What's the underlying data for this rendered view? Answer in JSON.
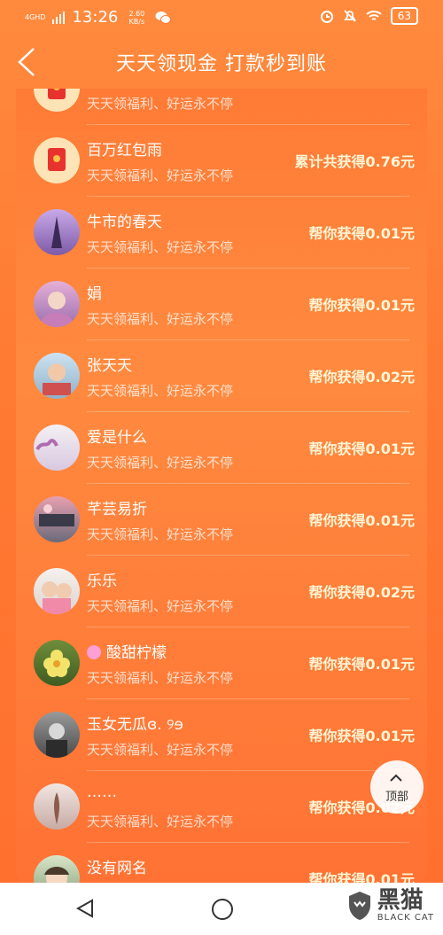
{
  "status": {
    "network": "4GHD",
    "time": "13:26",
    "speed": "2.60 KB/s",
    "battery": "63",
    "icons": [
      "signal-icon",
      "wechat-icon",
      "alarm-icon",
      "mute-icon",
      "wifi-icon",
      "battery-icon"
    ]
  },
  "header": {
    "title": "天天领现金 打款秒到账",
    "back_icon": "back-chevron-icon"
  },
  "rows": [
    {
      "name": "",
      "sub": "天天领福利、好运永不停",
      "amount": ""
    },
    {
      "name": "百万红包雨",
      "sub": "天天领福利、好运永不停",
      "amount": "累计共获得0.76元"
    },
    {
      "name": "牛市的春天",
      "sub": "天天领福利、好运永不停",
      "amount": "帮你获得0.01元"
    },
    {
      "name": "娟",
      "sub": "天天领福利、好运永不停",
      "amount": "帮你获得0.01元"
    },
    {
      "name": "张天天",
      "sub": "天天领福利、好运永不停",
      "amount": "帮你获得0.02元"
    },
    {
      "name": "爱是什么",
      "sub": "天天领福利、好运永不停",
      "amount": "帮你获得0.01元"
    },
    {
      "name": "芊芸易折",
      "sub": "天天领福利、好运永不停",
      "amount": "帮你获得0.01元"
    },
    {
      "name": "乐乐",
      "sub": "天天领福利、好运永不停",
      "amount": "帮你获得0.02元"
    },
    {
      "name": "酸甜柠檬",
      "sub": "天天领福利、好运永不停",
      "amount": "帮你获得0.01元"
    },
    {
      "name": "玉女无瓜ɞ. ୨ɘ",
      "sub": "天天领福利、好运永不停",
      "amount": "帮你获得0.01元"
    },
    {
      "name": "……",
      "sub": "天天领福利、好运永不停",
      "amount": "帮你获得0.02元"
    },
    {
      "name": "没有网名",
      "sub": "",
      "amount": "帮你获得0.01元"
    }
  ],
  "top_button": {
    "label": "顶部"
  },
  "watermark": {
    "text": "黑猫",
    "sub": "BLACK CAT"
  },
  "colors": {
    "background": "#ff7a33",
    "amount": "#fff6d6",
    "red_packet": "#e8322d"
  }
}
